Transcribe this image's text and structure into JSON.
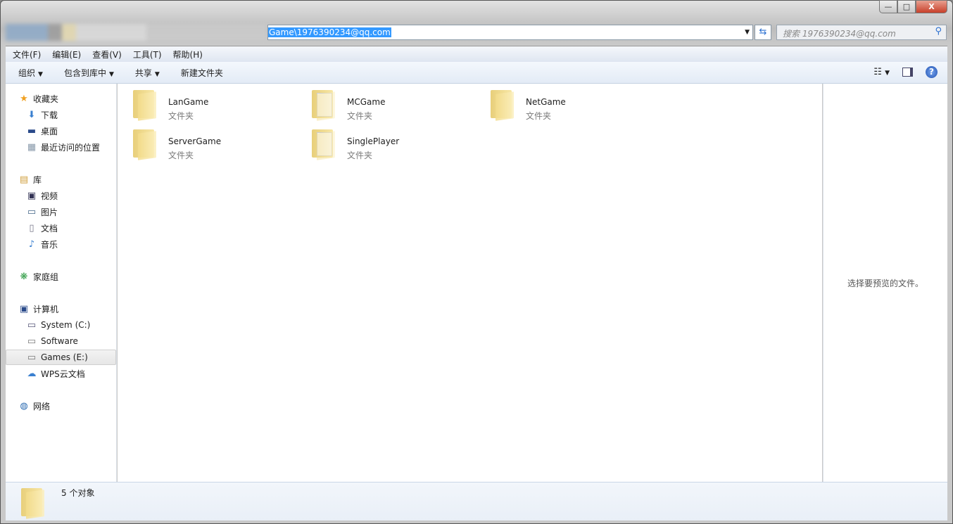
{
  "address": {
    "path": "Game\\1976390234@qq.com"
  },
  "search": {
    "placeholder": "搜索 1976390234@qq.com"
  },
  "window_controls": {
    "minimize": "—",
    "maximize": "□",
    "close": "X"
  },
  "menu": [
    "文件(F)",
    "编辑(E)",
    "查看(V)",
    "工具(T)",
    "帮助(H)"
  ],
  "toolbar": {
    "organize": "组织",
    "include": "包含到库中",
    "share": "共享",
    "new_folder": "新建文件夹"
  },
  "sidebar": {
    "favorites": {
      "label": "收藏夹",
      "items": [
        "下载",
        "桌面",
        "最近访问的位置"
      ]
    },
    "libraries": {
      "label": "库",
      "items": [
        "视频",
        "图片",
        "文档",
        "音乐"
      ]
    },
    "homegroup": "家庭组",
    "computer": {
      "label": "计算机",
      "items": [
        "System (C:)",
        "Software",
        "Games (E:)",
        "WPS云文档"
      ],
      "selected": "Games (E:)"
    },
    "network": "网络"
  },
  "files": [
    {
      "name": "LanGame",
      "type": "文件夹",
      "has_docs": false
    },
    {
      "name": "MCGame",
      "type": "文件夹",
      "has_docs": true
    },
    {
      "name": "NetGame",
      "type": "文件夹",
      "has_docs": false
    },
    {
      "name": "ServerGame",
      "type": "文件夹",
      "has_docs": false
    },
    {
      "name": "SinglePlayer",
      "type": "文件夹",
      "has_docs": true
    }
  ],
  "preview": {
    "message": "选择要预览的文件。"
  },
  "status": {
    "count": "5 个对象"
  },
  "colors": {
    "selection": "#3399ff",
    "toolbar": "#e3ebf6"
  }
}
